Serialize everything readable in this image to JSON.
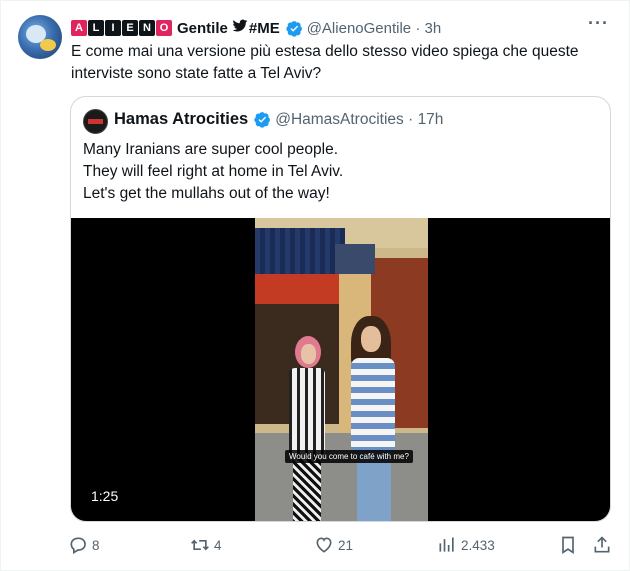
{
  "tweet": {
    "author": {
      "logo_letters": [
        "A",
        "L",
        "I",
        "E",
        "N",
        "O"
      ],
      "name": "Gentile",
      "suffix": "#ME",
      "handle": "@AlienoGentile",
      "time": "3h",
      "avatar_icon": "profile-avatar-icon"
    },
    "text": "E come mai una versione più estesa dello stesso video spiega che queste interviste sono state fatte a Tel Aviv?",
    "more_label": "···"
  },
  "quote": {
    "author": {
      "name": "Hamas Atrocities",
      "handle": "@HamasAtrocities",
      "time": "17h"
    },
    "lines": [
      "Many Iranians are super cool people.",
      "They will feel right at home in Tel Aviv.",
      "Let's get the mullahs out of the way!"
    ],
    "video": {
      "caption": "Would you come to café with me?",
      "duration": "1:25"
    }
  },
  "actions": {
    "reply_count": "8",
    "retweet_count": "4",
    "like_count": "21",
    "views_count": "2.433"
  },
  "colors": {
    "text": "#0f1419",
    "secondary": "#536471",
    "verified": "#1d9bf0",
    "logo_red": "#e0245e",
    "border": "#cfd9de"
  }
}
